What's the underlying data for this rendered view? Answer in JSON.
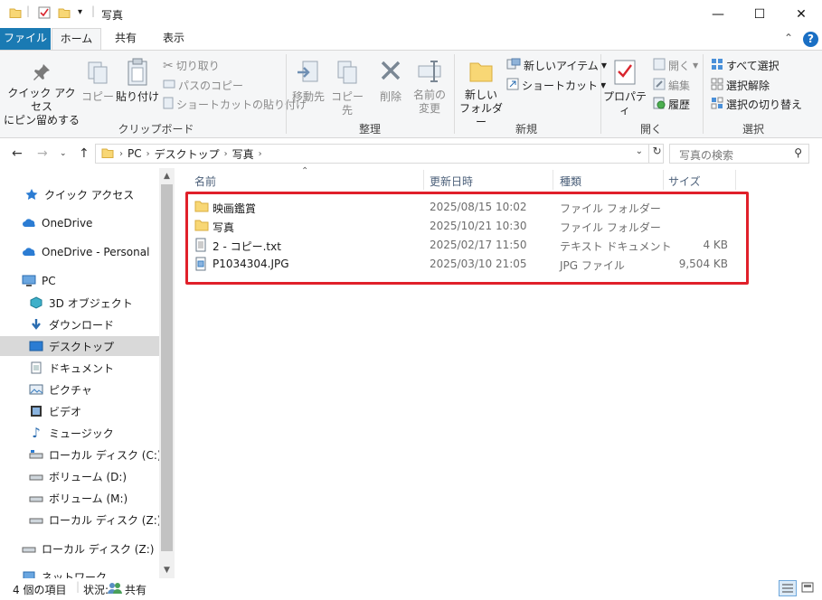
{
  "window": {
    "title": "写真",
    "quick_access_sep": "|",
    "qa_dropdown": "▾",
    "min_glyph": "—",
    "max_glyph": "☐",
    "close_glyph": "✕"
  },
  "ribbon_tabs": [
    {
      "label": "ファイル"
    },
    {
      "label": "ホーム"
    },
    {
      "label": "共有"
    },
    {
      "label": "表示"
    }
  ],
  "ribbon_right": {
    "collapse_glyph": "⌃",
    "help_glyph": "?"
  },
  "clipboard": {
    "pin_label_1": "クイック アクセス",
    "pin_label_2": "にピン留めする",
    "copy_label": "コピー",
    "paste_label": "貼り付け",
    "cut_label": "切り取り",
    "copy_path_label": "パスのコピー",
    "paste_shortcut_label": "ショートカットの貼り付け",
    "group_label": "クリップボード"
  },
  "organize": {
    "move_label": "移動先",
    "copyto_label": "コピー先",
    "delete_label": "削除",
    "rename_label_1": "名前の",
    "rename_label_2": "変更",
    "group_label": "整理"
  },
  "new": {
    "new_folder_label_1": "新しい",
    "new_folder_label_2": "フォルダー",
    "new_item_label": "新しいアイテム",
    "shortcut_label": "ショートカット",
    "group_label": "新規"
  },
  "open": {
    "properties_label": "プロパティ",
    "open_label": "開く",
    "edit_label": "編集",
    "history_label": "履歴",
    "group_label": "開く"
  },
  "select": {
    "select_all_label": "すべて選択",
    "select_none_label": "選択解除",
    "invert_label": "選択の切り替え",
    "group_label": "選択"
  },
  "address": {
    "crumbs": [
      "PC",
      "デスクトップ",
      "写真"
    ],
    "search_placeholder": "写真の検索"
  },
  "nav_pane": [
    {
      "label": "クイック アクセス",
      "icon": "star-icon"
    },
    {
      "label": "OneDrive",
      "icon": "cloud-icon"
    },
    {
      "label": "OneDrive - Personal",
      "icon": "cloud-icon"
    },
    {
      "label": "PC",
      "icon": "pc-icon"
    },
    {
      "label": "3D オブジェクト",
      "icon": "cube-icon"
    },
    {
      "label": "ダウンロード",
      "icon": "download-icon"
    },
    {
      "label": "デスクトップ",
      "icon": "desktop-icon"
    },
    {
      "label": "ドキュメント",
      "icon": "document-icon"
    },
    {
      "label": "ピクチャ",
      "icon": "picture-icon"
    },
    {
      "label": "ビデオ",
      "icon": "video-icon"
    },
    {
      "label": "ミュージック",
      "icon": "music-icon"
    },
    {
      "label": "ローカル ディスク (C:)",
      "icon": "drive-icon"
    },
    {
      "label": "ボリューム (D:)",
      "icon": "drive-icon"
    },
    {
      "label": "ボリューム (M:)",
      "icon": "drive-icon"
    },
    {
      "label": "ローカル ディスク (Z:)",
      "icon": "drive-icon"
    },
    {
      "label": "ローカル ディスク (Z:)",
      "icon": "drive-icon"
    },
    {
      "label": "ネットワーク",
      "icon": "network-icon"
    }
  ],
  "columns": {
    "name": "名前",
    "date": "更新日時",
    "type": "種類",
    "size": "サイズ"
  },
  "files": [
    {
      "name": "映画鑑賞",
      "date": "2025/08/15 10:02",
      "type": "ファイル フォルダー",
      "size": "",
      "icon": "folder-icon"
    },
    {
      "name": "写真",
      "date": "2025/10/21 10:30",
      "type": "ファイル フォルダー",
      "size": "",
      "icon": "folder-icon"
    },
    {
      "name": "2 - コピー.txt",
      "date": "2025/02/17 11:50",
      "type": "テキスト ドキュメント",
      "size": "4 KB",
      "icon": "text-file-icon"
    },
    {
      "name": "P1034304.JPG",
      "date": "2025/03/10 21:05",
      "type": "JPG ファイル",
      "size": "9,504 KB",
      "icon": "image-file-icon"
    }
  ],
  "status": {
    "item_count": "4 個の項目",
    "state_label": "状況:",
    "state_value": "共有"
  },
  "colors": {
    "accent": "#1a7ab3",
    "highlight": "#e0202a",
    "folder": "#f8d775"
  }
}
